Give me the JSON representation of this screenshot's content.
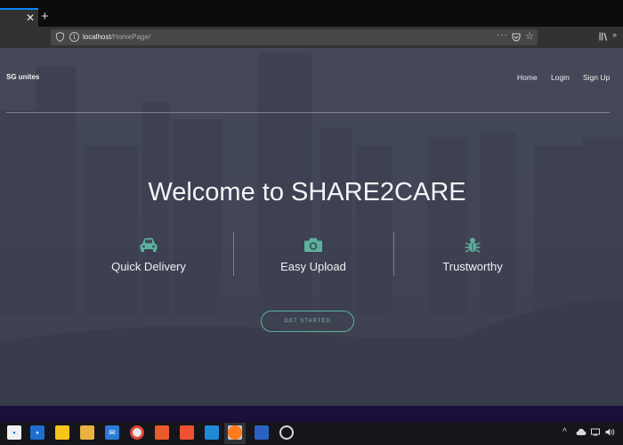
{
  "browser": {
    "tab_close_glyph": "✕",
    "new_tab_glyph": "+",
    "url_host": "localhost",
    "url_path": "/HomePage/",
    "url_more_glyph": "···",
    "bookmark_glyph": "☆",
    "menu_more_glyph": "»"
  },
  "site": {
    "brand": "SG unites",
    "nav": {
      "home": "Home",
      "login": "Login",
      "signup": "Sign Up"
    },
    "headline": "Welcome to SHARE2CARE",
    "features": [
      {
        "label": "Quick Delivery",
        "icon": "car-icon"
      },
      {
        "label": "Easy Upload",
        "icon": "camera-icon"
      },
      {
        "label": "Trustworthy",
        "icon": "bug-icon"
      }
    ],
    "cta": "GET STARTED",
    "accent_color": "#5ab39c"
  },
  "taskbar": {
    "apps": [
      "store-icon",
      "task-app-icon",
      "sticky-notes-icon",
      "file-explorer-icon",
      "mail-icon",
      "chrome-icon",
      "office-icon",
      "git-icon",
      "vscode-icon",
      "notes-icon",
      "firefox-icon",
      "sourcetree-icon",
      "clock-icon"
    ],
    "tray_glyph": "^"
  }
}
